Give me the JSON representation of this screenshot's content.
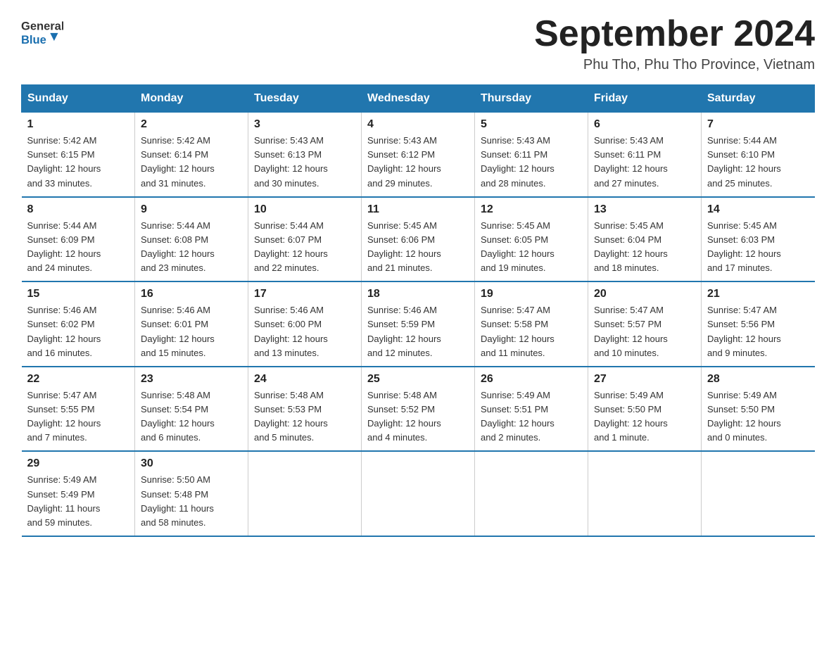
{
  "header": {
    "logo_general": "General",
    "logo_blue": "Blue",
    "month_title": "September 2024",
    "location": "Phu Tho, Phu Tho Province, Vietnam"
  },
  "days_of_week": [
    "Sunday",
    "Monday",
    "Tuesday",
    "Wednesday",
    "Thursday",
    "Friday",
    "Saturday"
  ],
  "weeks": [
    [
      {
        "day": "1",
        "info": "Sunrise: 5:42 AM\nSunset: 6:15 PM\nDaylight: 12 hours\nand 33 minutes."
      },
      {
        "day": "2",
        "info": "Sunrise: 5:42 AM\nSunset: 6:14 PM\nDaylight: 12 hours\nand 31 minutes."
      },
      {
        "day": "3",
        "info": "Sunrise: 5:43 AM\nSunset: 6:13 PM\nDaylight: 12 hours\nand 30 minutes."
      },
      {
        "day": "4",
        "info": "Sunrise: 5:43 AM\nSunset: 6:12 PM\nDaylight: 12 hours\nand 29 minutes."
      },
      {
        "day": "5",
        "info": "Sunrise: 5:43 AM\nSunset: 6:11 PM\nDaylight: 12 hours\nand 28 minutes."
      },
      {
        "day": "6",
        "info": "Sunrise: 5:43 AM\nSunset: 6:11 PM\nDaylight: 12 hours\nand 27 minutes."
      },
      {
        "day": "7",
        "info": "Sunrise: 5:44 AM\nSunset: 6:10 PM\nDaylight: 12 hours\nand 25 minutes."
      }
    ],
    [
      {
        "day": "8",
        "info": "Sunrise: 5:44 AM\nSunset: 6:09 PM\nDaylight: 12 hours\nand 24 minutes."
      },
      {
        "day": "9",
        "info": "Sunrise: 5:44 AM\nSunset: 6:08 PM\nDaylight: 12 hours\nand 23 minutes."
      },
      {
        "day": "10",
        "info": "Sunrise: 5:44 AM\nSunset: 6:07 PM\nDaylight: 12 hours\nand 22 minutes."
      },
      {
        "day": "11",
        "info": "Sunrise: 5:45 AM\nSunset: 6:06 PM\nDaylight: 12 hours\nand 21 minutes."
      },
      {
        "day": "12",
        "info": "Sunrise: 5:45 AM\nSunset: 6:05 PM\nDaylight: 12 hours\nand 19 minutes."
      },
      {
        "day": "13",
        "info": "Sunrise: 5:45 AM\nSunset: 6:04 PM\nDaylight: 12 hours\nand 18 minutes."
      },
      {
        "day": "14",
        "info": "Sunrise: 5:45 AM\nSunset: 6:03 PM\nDaylight: 12 hours\nand 17 minutes."
      }
    ],
    [
      {
        "day": "15",
        "info": "Sunrise: 5:46 AM\nSunset: 6:02 PM\nDaylight: 12 hours\nand 16 minutes."
      },
      {
        "day": "16",
        "info": "Sunrise: 5:46 AM\nSunset: 6:01 PM\nDaylight: 12 hours\nand 15 minutes."
      },
      {
        "day": "17",
        "info": "Sunrise: 5:46 AM\nSunset: 6:00 PM\nDaylight: 12 hours\nand 13 minutes."
      },
      {
        "day": "18",
        "info": "Sunrise: 5:46 AM\nSunset: 5:59 PM\nDaylight: 12 hours\nand 12 minutes."
      },
      {
        "day": "19",
        "info": "Sunrise: 5:47 AM\nSunset: 5:58 PM\nDaylight: 12 hours\nand 11 minutes."
      },
      {
        "day": "20",
        "info": "Sunrise: 5:47 AM\nSunset: 5:57 PM\nDaylight: 12 hours\nand 10 minutes."
      },
      {
        "day": "21",
        "info": "Sunrise: 5:47 AM\nSunset: 5:56 PM\nDaylight: 12 hours\nand 9 minutes."
      }
    ],
    [
      {
        "day": "22",
        "info": "Sunrise: 5:47 AM\nSunset: 5:55 PM\nDaylight: 12 hours\nand 7 minutes."
      },
      {
        "day": "23",
        "info": "Sunrise: 5:48 AM\nSunset: 5:54 PM\nDaylight: 12 hours\nand 6 minutes."
      },
      {
        "day": "24",
        "info": "Sunrise: 5:48 AM\nSunset: 5:53 PM\nDaylight: 12 hours\nand 5 minutes."
      },
      {
        "day": "25",
        "info": "Sunrise: 5:48 AM\nSunset: 5:52 PM\nDaylight: 12 hours\nand 4 minutes."
      },
      {
        "day": "26",
        "info": "Sunrise: 5:49 AM\nSunset: 5:51 PM\nDaylight: 12 hours\nand 2 minutes."
      },
      {
        "day": "27",
        "info": "Sunrise: 5:49 AM\nSunset: 5:50 PM\nDaylight: 12 hours\nand 1 minute."
      },
      {
        "day": "28",
        "info": "Sunrise: 5:49 AM\nSunset: 5:50 PM\nDaylight: 12 hours\nand 0 minutes."
      }
    ],
    [
      {
        "day": "29",
        "info": "Sunrise: 5:49 AM\nSunset: 5:49 PM\nDaylight: 11 hours\nand 59 minutes."
      },
      {
        "day": "30",
        "info": "Sunrise: 5:50 AM\nSunset: 5:48 PM\nDaylight: 11 hours\nand 58 minutes."
      },
      {
        "day": "",
        "info": ""
      },
      {
        "day": "",
        "info": ""
      },
      {
        "day": "",
        "info": ""
      },
      {
        "day": "",
        "info": ""
      },
      {
        "day": "",
        "info": ""
      }
    ]
  ]
}
